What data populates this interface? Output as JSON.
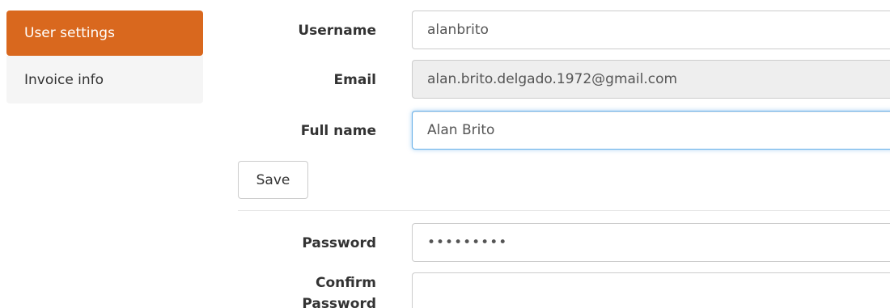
{
  "sidebar": {
    "items": [
      {
        "label": "User settings",
        "active": true
      },
      {
        "label": "Invoice info",
        "active": false
      }
    ]
  },
  "form": {
    "username": {
      "label": "Username",
      "value": "alanbrito"
    },
    "email": {
      "label": "Email",
      "value": "alan.brito.delgado.1972@gmail.com",
      "readonly": true
    },
    "fullname": {
      "label": "Full name",
      "value": "Alan Brito"
    },
    "save_label": "Save",
    "password": {
      "label": "Password",
      "value": "•••••••••"
    },
    "confirm_password": {
      "label": "Confirm Password",
      "value": ""
    }
  },
  "colors": {
    "accent": "#d9681e",
    "sidebar_bg": "#f5f5f5",
    "readonly_bg": "#eeeeee",
    "focus_border": "#66afe9"
  }
}
